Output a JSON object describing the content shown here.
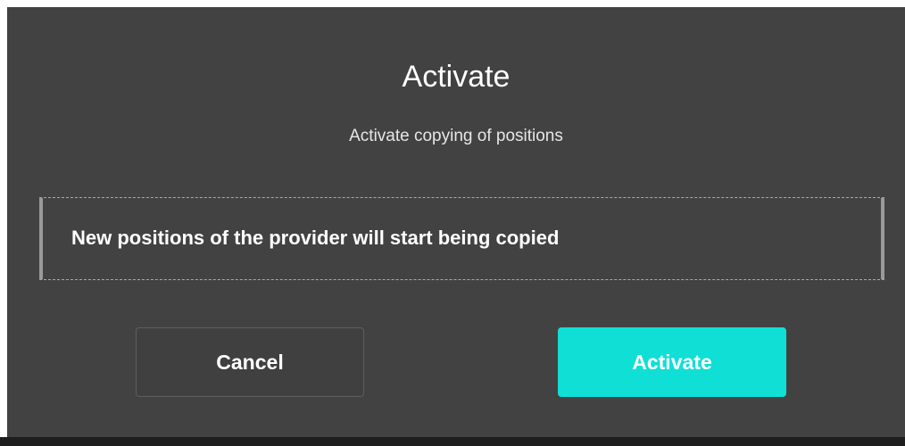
{
  "dialog": {
    "title": "Activate",
    "subtitle": "Activate copying of positions",
    "notice": "New positions of the provider will start being copied",
    "cancel_label": "Cancel",
    "confirm_label": "Activate"
  },
  "colors": {
    "dialog_background": "#424242",
    "accent": "#10dfd6",
    "text": "#ffffff"
  }
}
